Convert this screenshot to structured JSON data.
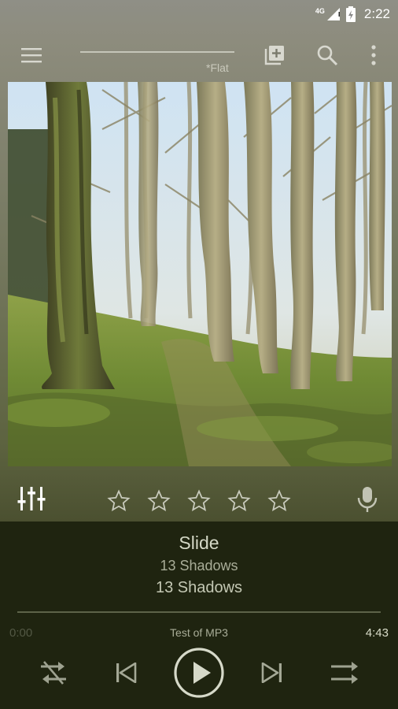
{
  "status_bar": {
    "network": "4G",
    "time": "2:22"
  },
  "toolbar": {
    "preset": "*Flat",
    "icons": [
      "menu-icon",
      "add-to-playlist-icon",
      "search-icon",
      "more-vert-icon"
    ]
  },
  "album_art": {
    "subject": "forest"
  },
  "rating": {
    "stars_total": 5,
    "stars_filled": 0
  },
  "track": {
    "title": "Slide",
    "artist": "13 Shadows",
    "album": "13 Shadows",
    "codec": "Test of MP3",
    "time_current": "0:00",
    "time_total": "4:43"
  },
  "colors": {
    "bottom_panel": "#1f2410",
    "accent_text": "#d4d8c6"
  }
}
